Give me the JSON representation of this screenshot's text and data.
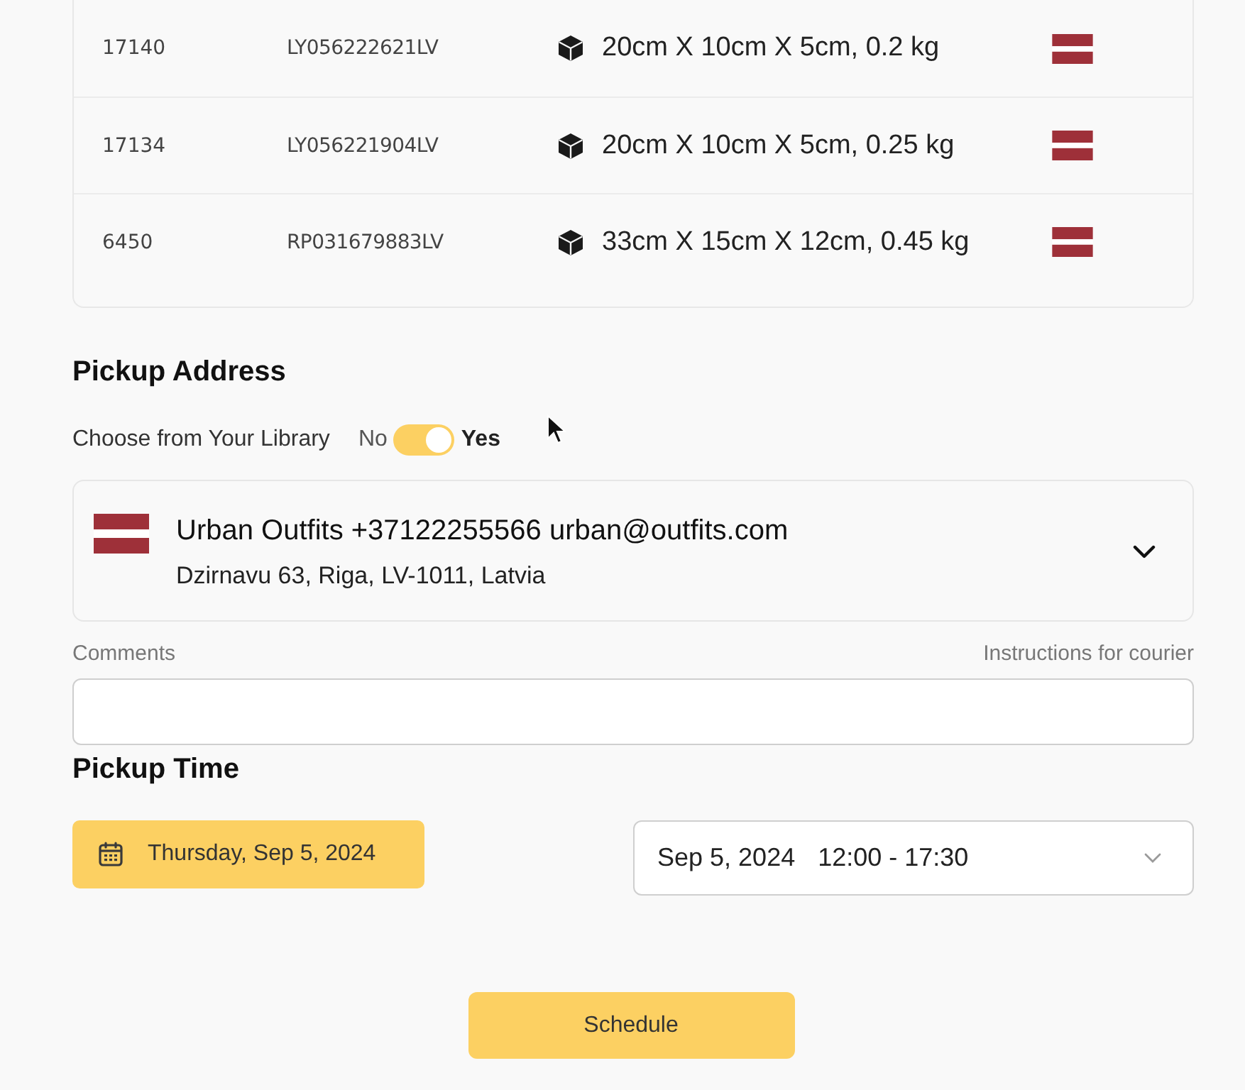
{
  "shipments": {
    "rows": [
      {
        "number": "17140",
        "tracking": "LY056222621LV",
        "dimensions": "20cm X 10cm X 5cm, 0.2 kg"
      },
      {
        "number": "17134",
        "tracking": "LY056221904LV",
        "dimensions": "20cm X 10cm X 5cm, 0.25 kg"
      },
      {
        "number": "6450",
        "tracking": "RP031679883LV",
        "dimensions": "33cm X 15cm X 12cm, 0.45 kg"
      }
    ]
  },
  "pickup_address": {
    "title": "Pickup Address",
    "library_toggle": {
      "label": "Choose from Your Library",
      "off_label": "No",
      "on_label": "Yes",
      "on": true
    },
    "address": {
      "name_line": "Urban Outfits +37122255566 urban@outfits.com",
      "address_line": "Dzirnavu 63, Riga, LV-1011, Latvia"
    },
    "comments": {
      "label": "Comments",
      "hint": "Instructions for courier"
    }
  },
  "pickup_time": {
    "title": "Pickup Time",
    "date_button": "Thursday, Sep 5, 2024",
    "slot": {
      "date": "Sep 5, 2024",
      "time": "12:00 - 17:30"
    }
  },
  "schedule_button": "Schedule"
}
